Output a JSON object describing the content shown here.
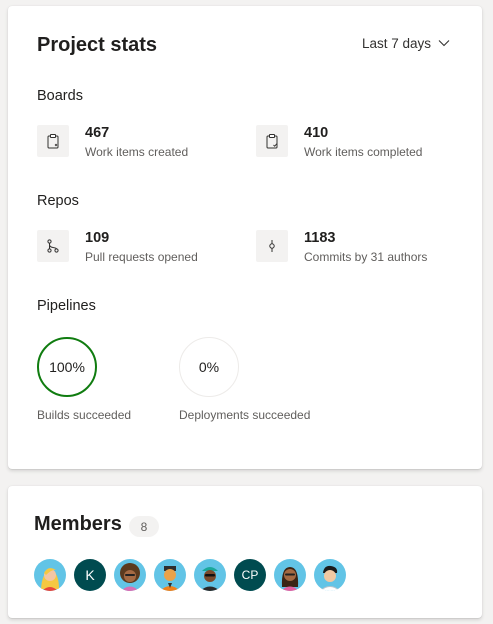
{
  "project_stats": {
    "title": "Project stats",
    "range_label": "Last 7 days",
    "boards": {
      "title": "Boards",
      "stats": [
        {
          "value": "467",
          "label": "Work items created",
          "icon": "clipboard-icon"
        },
        {
          "value": "410",
          "label": "Work items completed",
          "icon": "clipboard-check-icon"
        }
      ]
    },
    "repos": {
      "title": "Repos",
      "stats": [
        {
          "value": "109",
          "label": "Pull requests opened",
          "icon": "pull-request-icon"
        },
        {
          "value": "1183",
          "label": "Commits by 31 authors",
          "icon": "commit-icon"
        }
      ]
    },
    "pipelines": {
      "title": "Pipelines",
      "builds": {
        "value": "100%",
        "label": "Builds succeeded",
        "fraction": 1.0,
        "color": "#107c10"
      },
      "deployments": {
        "value": "0%",
        "label": "Deployments succeeded",
        "fraction": 0.0
      }
    }
  },
  "members": {
    "title": "Members",
    "count": "8",
    "avatars": [
      {
        "type": "image",
        "icon": "person-avatar-blonde"
      },
      {
        "type": "initials",
        "text": "K",
        "color": "#004b50"
      },
      {
        "type": "image",
        "icon": "person-avatar-curly-hair"
      },
      {
        "type": "image",
        "icon": "person-avatar-orange-shirt"
      },
      {
        "type": "image",
        "icon": "person-avatar-glasses-cap"
      },
      {
        "type": "initials",
        "text": "CP",
        "color": "#004b50"
      },
      {
        "type": "image",
        "icon": "person-avatar-long-hair"
      },
      {
        "type": "image",
        "icon": "person-avatar-black-hair"
      }
    ]
  }
}
